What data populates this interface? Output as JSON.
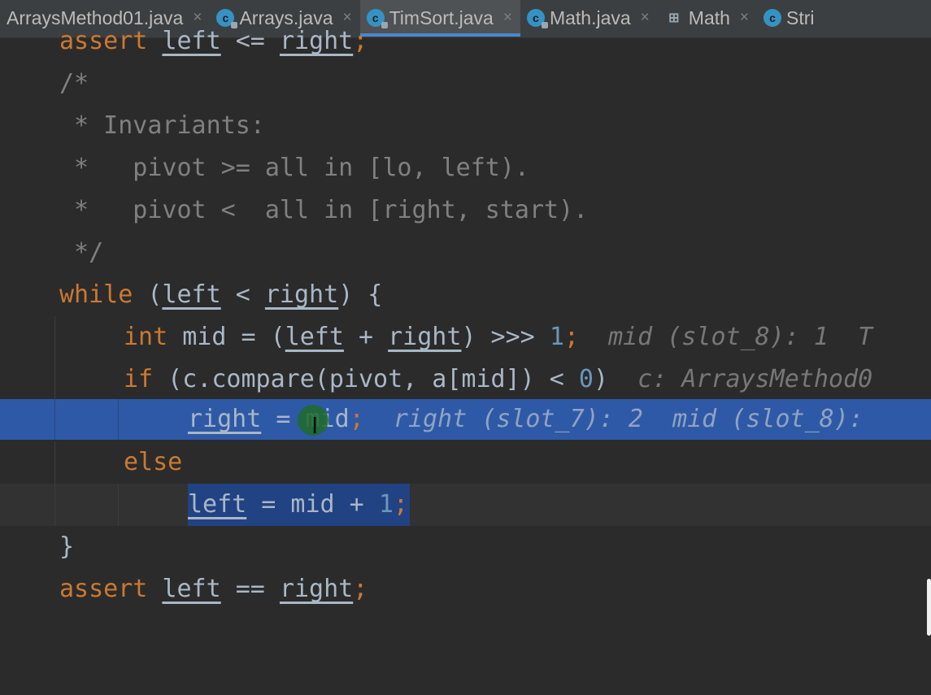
{
  "tabs": [
    {
      "label": "ArraysMethod01.java",
      "icon": "none",
      "active": false
    },
    {
      "label": "Arrays.java",
      "icon": "class-icon",
      "active": false
    },
    {
      "label": "TimSort.java",
      "icon": "class-icon",
      "active": true
    },
    {
      "label": "Math.java",
      "icon": "class-icon",
      "active": false
    },
    {
      "label": "Math",
      "icon": "structure-icon",
      "active": false
    },
    {
      "label": "Stri",
      "icon": "class-icon",
      "active": false
    }
  ],
  "code": {
    "l0": {
      "kw": "assert",
      "a": "left",
      "op": " <= ",
      "b": "right",
      "end": ";"
    },
    "l1": "/*",
    "l2": " * Invariants:",
    "l3": " *   pivot >= all in [lo, left).",
    "l4": " *   pivot <  all in [right, start).",
    "l5": " */",
    "l6": {
      "kw": "while",
      "p1": " (",
      "a": "left",
      "op": " < ",
      "b": "right",
      "p2": ") {"
    },
    "l7": {
      "kw": "int",
      "t1": " mid = (",
      "a": "left",
      "op": " + ",
      "b": "right",
      "t2": ") >>> ",
      "num": "1",
      "end": ";",
      "hint": "mid (slot_8): 1  T"
    },
    "l8": {
      "kw": "if",
      "t1": " (c.compare(pivot, a[mid]) < ",
      "num": "0",
      "t2": ")",
      "hint": "c: ArraysMethod0"
    },
    "l9": {
      "a": "right",
      "t1": " = mid",
      "end": ";",
      "hint": "right (slot_7): 2  mid (slot_8):"
    },
    "l10": {
      "kw": "else"
    },
    "l11": {
      "a": "left",
      "t1": " = mid + ",
      "num": "1",
      "end": ";"
    },
    "l12": "}",
    "l13": {
      "kw": "assert",
      "a": "left",
      "op": " == ",
      "b": "right",
      "end": ";"
    }
  }
}
